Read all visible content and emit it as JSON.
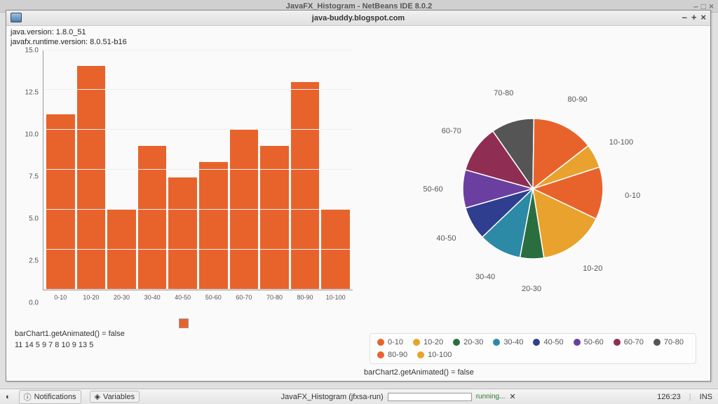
{
  "outer_title": "JavaFX_Histogram - NetBeans IDE 8.0.2",
  "inner_title": "java-buddy.blogspot.com",
  "info": {
    "java_version_label": "java.version: 1.8.0_51",
    "javafx_runtime_label": "javafx.runtime.version: 8.0.51-b16"
  },
  "chart_data": [
    {
      "type": "bar",
      "categories": [
        "0-10",
        "10-20",
        "20-30",
        "30-40",
        "40-50",
        "50-60",
        "60-70",
        "70-80",
        "80-90",
        "10-100"
      ],
      "values": [
        11,
        14,
        5,
        9,
        7,
        8,
        10,
        9,
        13,
        5
      ],
      "y_ticks": [
        0.0,
        2.5,
        5.0,
        7.5,
        10.0,
        12.5,
        15.0
      ],
      "ylim": [
        0,
        15
      ],
      "color": "#e8632c"
    },
    {
      "type": "pie",
      "slices": [
        {
          "label": "0-10",
          "value": 11,
          "color": "#e8632c"
        },
        {
          "label": "10-20",
          "value": 14,
          "color": "#e9a22d"
        },
        {
          "label": "20-30",
          "value": 5,
          "color": "#2a6e3f"
        },
        {
          "label": "30-40",
          "value": 9,
          "color": "#2d8aa6"
        },
        {
          "label": "40-50",
          "value": 7,
          "color": "#2f3e8f"
        },
        {
          "label": "50-60",
          "value": 8,
          "color": "#6b3fa0"
        },
        {
          "label": "60-70",
          "value": 10,
          "color": "#8f2d52"
        },
        {
          "label": "70-80",
          "value": 9,
          "color": "#555555"
        },
        {
          "label": "80-90",
          "value": 13,
          "color": "#e8632c"
        },
        {
          "label": "10-100",
          "value": 5,
          "color": "#e9a22d"
        }
      ]
    }
  ],
  "bar_status": {
    "line1": "barChart1.getAnimated() = false",
    "line2": "11 14 5 9 7 8 10 9 13 5"
  },
  "pie_status": {
    "line1": "barChart2.getAnimated() = false"
  },
  "ide": {
    "notifications": "Notifications",
    "variables": "Variables",
    "task_label": "JavaFX_Histogram (jfxsa-run)",
    "running": "running...",
    "cursor_pos": "126:23",
    "ins": "INS"
  }
}
